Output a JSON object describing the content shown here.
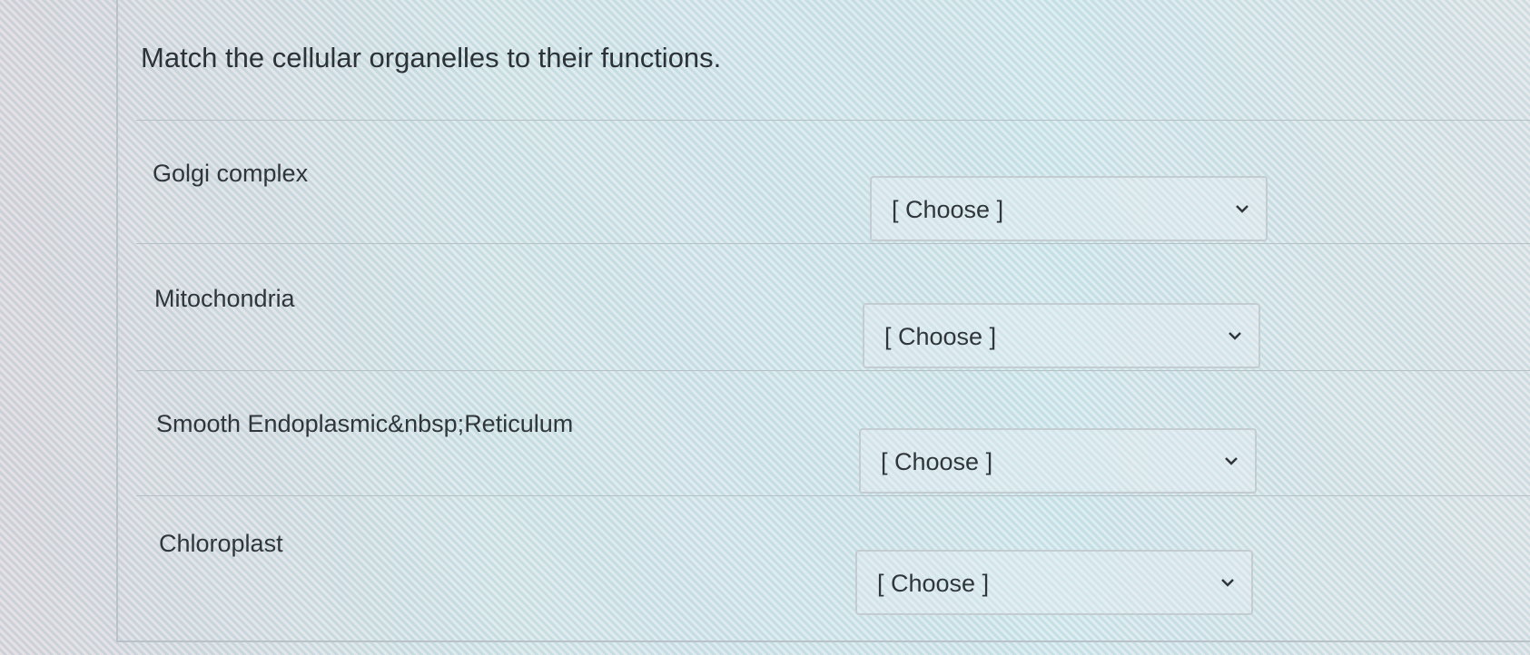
{
  "question": {
    "title": "Match the cellular organelles to their functions."
  },
  "rows": [
    {
      "label": "Golgi complex",
      "select_value": "[ Choose ]"
    },
    {
      "label": "Mitochondria",
      "select_value": "[ Choose ]"
    },
    {
      "label": "Smooth Endoplasmic&nbsp;Reticulum",
      "select_value": "[ Choose ]"
    },
    {
      "label": "Chloroplast",
      "select_value": "[ Choose ]"
    }
  ]
}
